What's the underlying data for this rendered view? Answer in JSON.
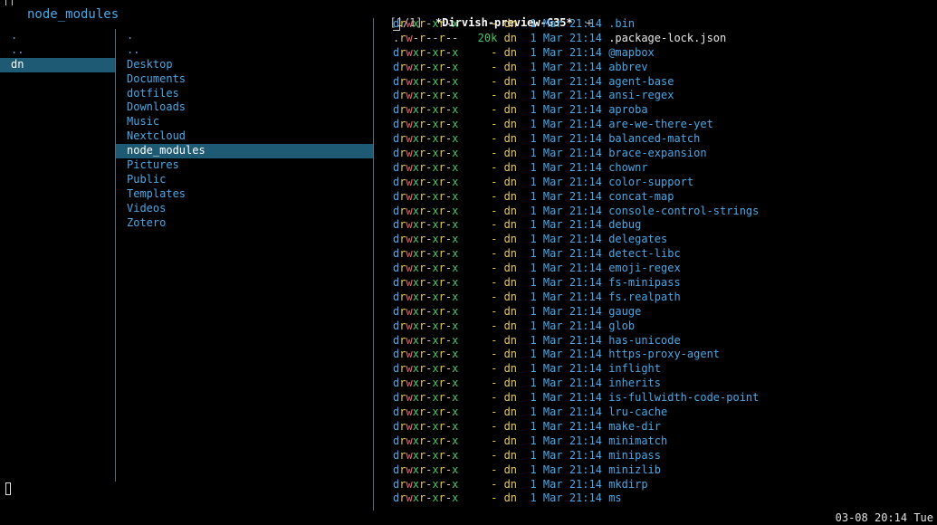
{
  "header": {
    "path": "node_modules"
  },
  "parent_column": {
    "items": [
      {
        "label": ".",
        "selected": false
      },
      {
        "label": "..",
        "selected": false
      },
      {
        "label": "dn",
        "selected": true
      }
    ]
  },
  "current_column": {
    "items": [
      {
        "label": ".",
        "selected": false
      },
      {
        "label": "..",
        "selected": false
      },
      {
        "label": "Desktop",
        "selected": false
      },
      {
        "label": "Documents",
        "selected": false
      },
      {
        "label": "dotfiles",
        "selected": false
      },
      {
        "label": "Downloads",
        "selected": false
      },
      {
        "label": "Music",
        "selected": false
      },
      {
        "label": "Nextcloud",
        "selected": false
      },
      {
        "label": "node_modules",
        "selected": true
      },
      {
        "label": "Pictures",
        "selected": false
      },
      {
        "label": "Public",
        "selected": false
      },
      {
        "label": "Templates",
        "selected": false
      },
      {
        "label": "Videos",
        "selected": false
      },
      {
        "label": "Zotero",
        "selected": false
      }
    ]
  },
  "tabline": {
    "count": "[1/1]",
    "name": "*Dirvish-preview-G35*",
    "plus": "+"
  },
  "preview": {
    "entries": [
      {
        "perm": "drwxr-xr-x",
        "size": "-",
        "user": "dn",
        "date": "1 Mar 21:14",
        "name": ".bin",
        "is_dir": true
      },
      {
        "perm": ".rw-r--r--",
        "size": "20k",
        "user": "dn",
        "date": "1 Mar 21:14",
        "name": ".package-lock.json",
        "is_dir": false
      },
      {
        "perm": "drwxr-xr-x",
        "size": "-",
        "user": "dn",
        "date": "1 Mar 21:14",
        "name": "@mapbox",
        "is_dir": true
      },
      {
        "perm": "drwxr-xr-x",
        "size": "-",
        "user": "dn",
        "date": "1 Mar 21:14",
        "name": "abbrev",
        "is_dir": true
      },
      {
        "perm": "drwxr-xr-x",
        "size": "-",
        "user": "dn",
        "date": "1 Mar 21:14",
        "name": "agent-base",
        "is_dir": true
      },
      {
        "perm": "drwxr-xr-x",
        "size": "-",
        "user": "dn",
        "date": "1 Mar 21:14",
        "name": "ansi-regex",
        "is_dir": true
      },
      {
        "perm": "drwxr-xr-x",
        "size": "-",
        "user": "dn",
        "date": "1 Mar 21:14",
        "name": "aproba",
        "is_dir": true
      },
      {
        "perm": "drwxr-xr-x",
        "size": "-",
        "user": "dn",
        "date": "1 Mar 21:14",
        "name": "are-we-there-yet",
        "is_dir": true
      },
      {
        "perm": "drwxr-xr-x",
        "size": "-",
        "user": "dn",
        "date": "1 Mar 21:14",
        "name": "balanced-match",
        "is_dir": true
      },
      {
        "perm": "drwxr-xr-x",
        "size": "-",
        "user": "dn",
        "date": "1 Mar 21:14",
        "name": "brace-expansion",
        "is_dir": true
      },
      {
        "perm": "drwxr-xr-x",
        "size": "-",
        "user": "dn",
        "date": "1 Mar 21:14",
        "name": "chownr",
        "is_dir": true
      },
      {
        "perm": "drwxr-xr-x",
        "size": "-",
        "user": "dn",
        "date": "1 Mar 21:14",
        "name": "color-support",
        "is_dir": true
      },
      {
        "perm": "drwxr-xr-x",
        "size": "-",
        "user": "dn",
        "date": "1 Mar 21:14",
        "name": "concat-map",
        "is_dir": true
      },
      {
        "perm": "drwxr-xr-x",
        "size": "-",
        "user": "dn",
        "date": "1 Mar 21:14",
        "name": "console-control-strings",
        "is_dir": true
      },
      {
        "perm": "drwxr-xr-x",
        "size": "-",
        "user": "dn",
        "date": "1 Mar 21:14",
        "name": "debug",
        "is_dir": true
      },
      {
        "perm": "drwxr-xr-x",
        "size": "-",
        "user": "dn",
        "date": "1 Mar 21:14",
        "name": "delegates",
        "is_dir": true
      },
      {
        "perm": "drwxr-xr-x",
        "size": "-",
        "user": "dn",
        "date": "1 Mar 21:14",
        "name": "detect-libc",
        "is_dir": true
      },
      {
        "perm": "drwxr-xr-x",
        "size": "-",
        "user": "dn",
        "date": "1 Mar 21:14",
        "name": "emoji-regex",
        "is_dir": true
      },
      {
        "perm": "drwxr-xr-x",
        "size": "-",
        "user": "dn",
        "date": "1 Mar 21:14",
        "name": "fs-minipass",
        "is_dir": true
      },
      {
        "perm": "drwxr-xr-x",
        "size": "-",
        "user": "dn",
        "date": "1 Mar 21:14",
        "name": "fs.realpath",
        "is_dir": true
      },
      {
        "perm": "drwxr-xr-x",
        "size": "-",
        "user": "dn",
        "date": "1 Mar 21:14",
        "name": "gauge",
        "is_dir": true
      },
      {
        "perm": "drwxr-xr-x",
        "size": "-",
        "user": "dn",
        "date": "1 Mar 21:14",
        "name": "glob",
        "is_dir": true
      },
      {
        "perm": "drwxr-xr-x",
        "size": "-",
        "user": "dn",
        "date": "1 Mar 21:14",
        "name": "has-unicode",
        "is_dir": true
      },
      {
        "perm": "drwxr-xr-x",
        "size": "-",
        "user": "dn",
        "date": "1 Mar 21:14",
        "name": "https-proxy-agent",
        "is_dir": true
      },
      {
        "perm": "drwxr-xr-x",
        "size": "-",
        "user": "dn",
        "date": "1 Mar 21:14",
        "name": "inflight",
        "is_dir": true
      },
      {
        "perm": "drwxr-xr-x",
        "size": "-",
        "user": "dn",
        "date": "1 Mar 21:14",
        "name": "inherits",
        "is_dir": true
      },
      {
        "perm": "drwxr-xr-x",
        "size": "-",
        "user": "dn",
        "date": "1 Mar 21:14",
        "name": "is-fullwidth-code-point",
        "is_dir": true
      },
      {
        "perm": "drwxr-xr-x",
        "size": "-",
        "user": "dn",
        "date": "1 Mar 21:14",
        "name": "lru-cache",
        "is_dir": true
      },
      {
        "perm": "drwxr-xr-x",
        "size": "-",
        "user": "dn",
        "date": "1 Mar 21:14",
        "name": "make-dir",
        "is_dir": true
      },
      {
        "perm": "drwxr-xr-x",
        "size": "-",
        "user": "dn",
        "date": "1 Mar 21:14",
        "name": "minimatch",
        "is_dir": true
      },
      {
        "perm": "drwxr-xr-x",
        "size": "-",
        "user": "dn",
        "date": "1 Mar 21:14",
        "name": "minipass",
        "is_dir": true
      },
      {
        "perm": "drwxr-xr-x",
        "size": "-",
        "user": "dn",
        "date": "1 Mar 21:14",
        "name": "minizlib",
        "is_dir": true
      },
      {
        "perm": "drwxr-xr-x",
        "size": "-",
        "user": "dn",
        "date": "1 Mar 21:14",
        "name": "mkdirp",
        "is_dir": true
      },
      {
        "perm": "drwxr-xr-x",
        "size": "-",
        "user": "dn",
        "date": "1 Mar 21:14",
        "name": "ms",
        "is_dir": true
      }
    ]
  },
  "status": {
    "datetime": "03-08 20:14 Tue"
  },
  "colors": {
    "directory": "#4aa8e8",
    "selection": "#1f5a75",
    "read": "#e8c84a",
    "write": "#e86a6a",
    "execute": "#4ac868"
  }
}
